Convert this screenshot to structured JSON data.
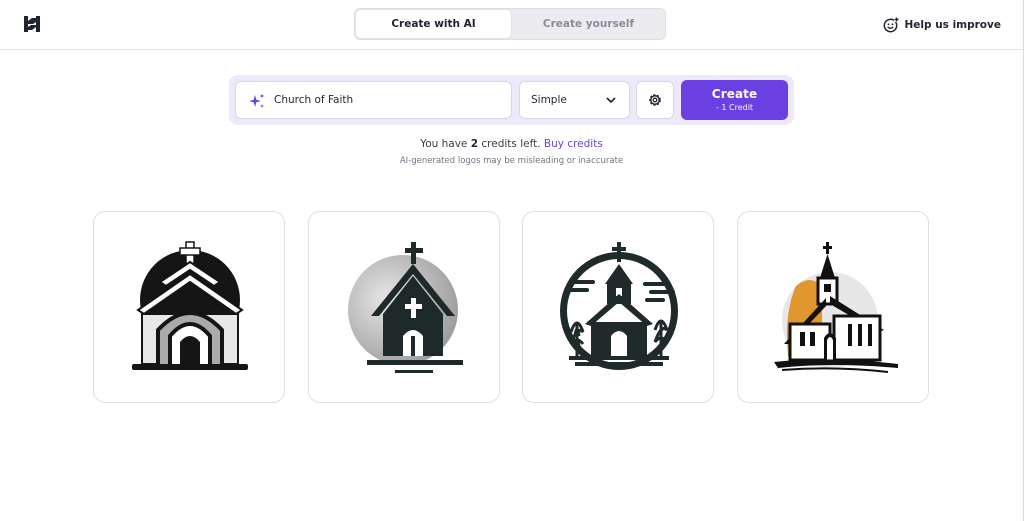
{
  "header": {
    "logo_icon": "brand-h-logo",
    "tabs": [
      {
        "label": "Create with AI",
        "active": true
      },
      {
        "label": "Create yourself",
        "active": false
      }
    ],
    "help_label": "Help us improve",
    "help_icon": "smiley-plus-icon"
  },
  "prompt": {
    "value": "Church of Faith",
    "icon": "sparkle-icon"
  },
  "style_select": {
    "value": "Simple"
  },
  "settings_icon": "gear-icon",
  "create_button": {
    "label": "Create",
    "sublabel": "- 1 Credit",
    "color": "#6b40e3"
  },
  "credits": {
    "prefix": "You have",
    "count": "2",
    "suffix": "credits left.",
    "buy_label": "Buy credits"
  },
  "disclaimer": "AI-generated logos may be misleading or inaccurate",
  "results": [
    {
      "name": "logo-option-1",
      "description_icon": "church-logo-icon"
    },
    {
      "name": "logo-option-2",
      "description_icon": "church-logo-icon"
    },
    {
      "name": "logo-option-3",
      "description_icon": "church-logo-icon"
    },
    {
      "name": "logo-option-4",
      "description_icon": "church-logo-icon"
    }
  ],
  "colors": {
    "accent": "#6b40e3",
    "accent_bg": "#ede9fb",
    "logo4_accent": "#e2962e"
  }
}
